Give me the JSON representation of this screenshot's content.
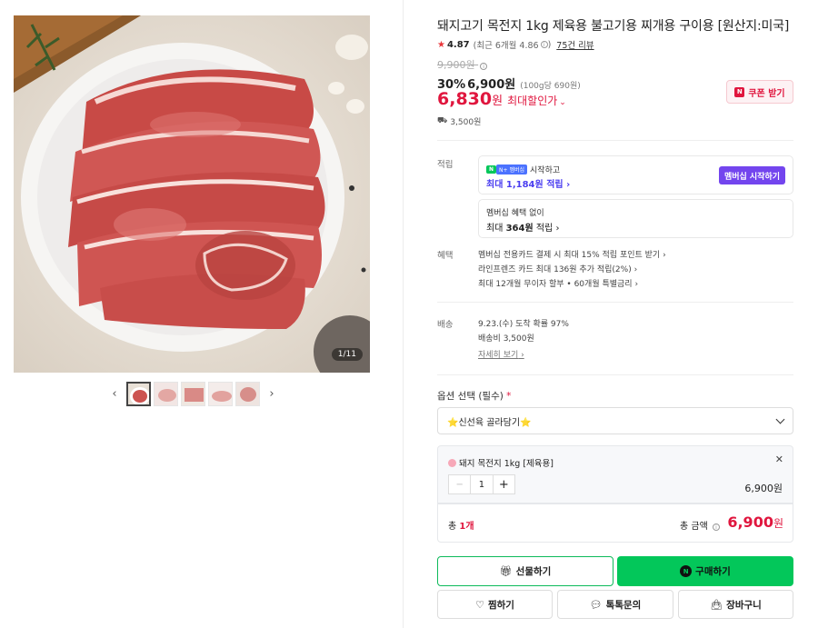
{
  "gallery": {
    "counter": "1/11",
    "thumb_count": 5,
    "selected_thumb": 1
  },
  "product": {
    "title": "돼지고기 목전지 1kg 제육용 불고기용 찌개용 구이용 [원산지:미국]",
    "rating": "4.87",
    "rating_detail": "(최근 6개월 4.86",
    "review_count": "75건 리뷰",
    "original_price": "9,900원",
    "discount_rate": "30%",
    "sale_price": "6,900원",
    "unit_price": "(100g당 690원)",
    "final_price": "6,830",
    "final_suffix": "원",
    "max_discount_label": "최대할인가",
    "coupon_label": "쿠폰 받기",
    "shipping_fee": "3,500원"
  },
  "points": {
    "label": "적립",
    "member_badge": "N+ 멤버십",
    "member_start_text": "시작하고",
    "member_max": "최대 1,184원 적립",
    "member_button": "멤버십 시작하기",
    "nonmember_text": "멤버십 혜택 없이",
    "nonmember_max_prefix": "최대 ",
    "nonmember_max_amount": "364원",
    "nonmember_max_suffix": " 적립"
  },
  "benefits": {
    "label": "혜택",
    "items": [
      "멤버십 전용카드 결제 시 최대 15% 적립 포인트 받기",
      "라인프렌즈 카드 최대 136원 추가 적립(2%)",
      "최대 12개월 무이자 할부 • 60개월 특별금리"
    ]
  },
  "delivery": {
    "label": "배송",
    "arrival": "9.23.(수) 도착 확률 97%",
    "fee": "배송비 3,500원",
    "detail_link": "자세히 보기"
  },
  "option": {
    "label": "옵션 선택 (필수)",
    "required_mark": "*",
    "selected_value": "⭐신선육 골라담기⭐"
  },
  "selected_item": {
    "name": "돼지 목전지 1kg [제육용]",
    "quantity": "1",
    "price": "6,900원"
  },
  "total": {
    "qty_prefix": "총 ",
    "qty_value": "1개",
    "label": "총 금액",
    "amount": "6,900",
    "amount_unit": "원"
  },
  "buttons": {
    "gift": "선물하기",
    "buy": "구매하기",
    "wish": "찜하기",
    "talk": "톡톡문의",
    "cart": "장바구니"
  },
  "colors": {
    "accent_red": "#e0163e",
    "naver_green": "#03c75a",
    "membership_purple": "#7345ee"
  }
}
